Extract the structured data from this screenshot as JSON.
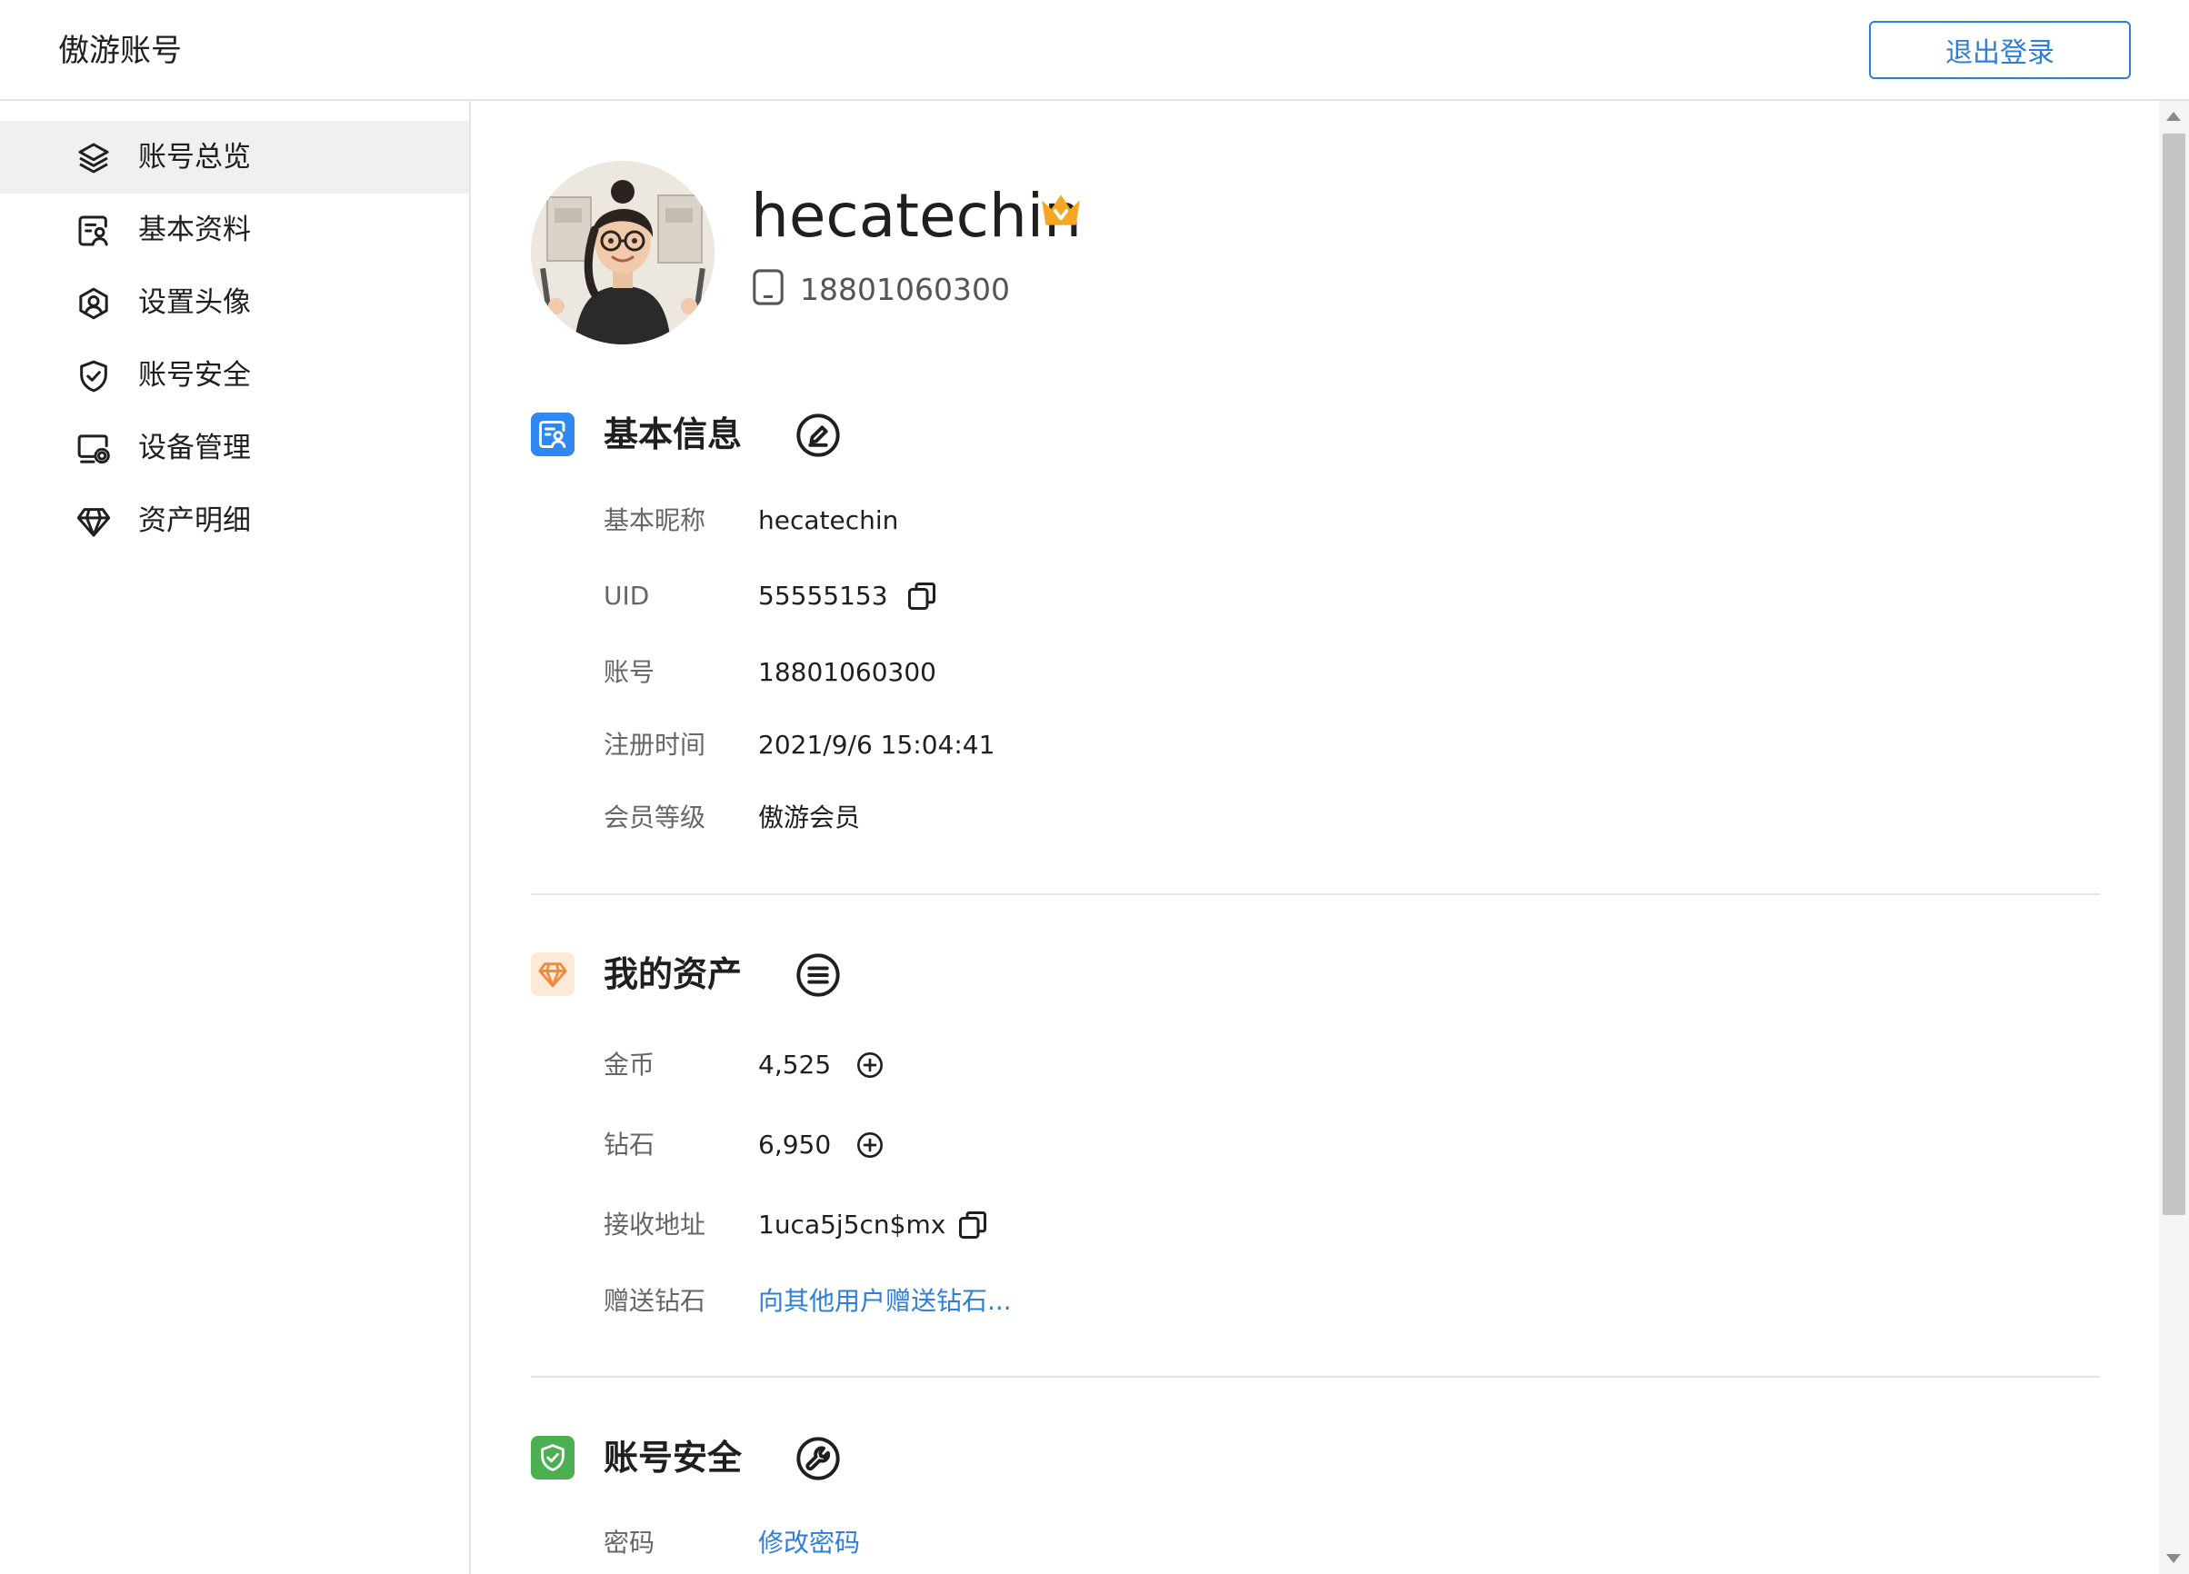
{
  "header": {
    "app_title": "傲游账号",
    "logout_label": "退出登录"
  },
  "sidebar": {
    "items": [
      {
        "label": "账号总览",
        "icon": "layers-icon",
        "active": true
      },
      {
        "label": "基本资料",
        "icon": "profile-card-icon",
        "active": false
      },
      {
        "label": "设置头像",
        "icon": "avatar-badge-icon",
        "active": false
      },
      {
        "label": "账号安全",
        "icon": "shield-check-icon",
        "active": false
      },
      {
        "label": "设备管理",
        "icon": "device-settings-icon",
        "active": false
      },
      {
        "label": "资产明细",
        "icon": "diamond-icon",
        "active": false
      }
    ]
  },
  "profile": {
    "username": "hecatechin",
    "phone": "18801060300"
  },
  "basic_info": {
    "title": "基本信息",
    "rows": [
      {
        "label": "基本昵称",
        "value": "hecatechin"
      },
      {
        "label": "UID",
        "value": "55555153"
      },
      {
        "label": "账号",
        "value": "18801060300"
      },
      {
        "label": "注册时间",
        "value": "2021/9/6 15:04:41"
      },
      {
        "label": "会员等级",
        "value": "傲游会员"
      }
    ]
  },
  "assets": {
    "title": "我的资产",
    "rows": [
      {
        "label": "金币",
        "value": "4,525"
      },
      {
        "label": "钻石",
        "value": "6,950"
      },
      {
        "label": "接收地址",
        "value": "1uca5j5cn$mx"
      },
      {
        "label": "赠送钻石",
        "value": "向其他用户赠送钻石..."
      }
    ]
  },
  "security": {
    "title": "账号安全",
    "rows": [
      {
        "label": "密码",
        "value": "修改密码"
      }
    ]
  },
  "colors": {
    "accent": "#2e7fdb",
    "basic_info_icon": "#2f87f0",
    "assets_icon": "#f08a3c",
    "security_icon": "#4cb050",
    "crown": "#f5a623"
  }
}
